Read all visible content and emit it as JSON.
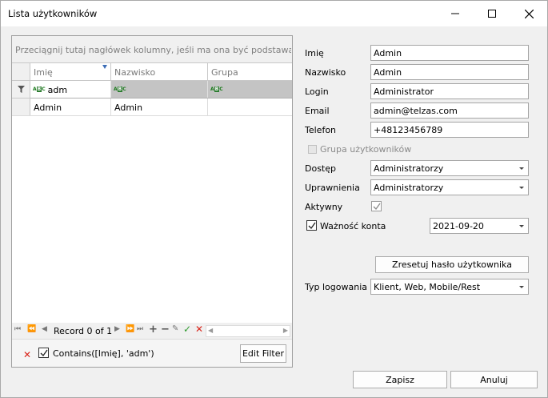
{
  "window": {
    "title": "Lista użytkowników"
  },
  "grid": {
    "group_panel_text": "Przeciągnij tutaj nagłówek kolumny, jeśli ma ona być podstawą grupow",
    "columns": [
      "Imię",
      "Nazwisko",
      "Grupa"
    ],
    "filter_row": {
      "imie": "adm",
      "nazwisko": "",
      "grupa": ""
    },
    "rows": [
      {
        "imie": "Admin",
        "nazwisko": "Admin",
        "grupa": ""
      }
    ],
    "navigator": {
      "record_text": "Record 0 of 1"
    },
    "filter_panel": {
      "text": "Contains([Imię], 'adm')",
      "edit_filter_label": "Edit Filter",
      "enabled": true
    }
  },
  "form": {
    "imie": {
      "label": "Imię",
      "value": "Admin"
    },
    "nazwisko": {
      "label": "Nazwisko",
      "value": "Admin"
    },
    "login": {
      "label": "Login",
      "value": "Administrator"
    },
    "email": {
      "label": "Email",
      "value": "admin@telzas.com"
    },
    "telefon": {
      "label": "Telefon",
      "value": "+48123456789"
    },
    "grupa_uzytkownikow": {
      "label": "Grupa użytkowników",
      "checked": false,
      "disabled": true
    },
    "dostep": {
      "label": "Dostęp",
      "value": "Administratorzy"
    },
    "uprawnienia": {
      "label": "Uprawnienia",
      "value": "Administratorzy"
    },
    "aktywny": {
      "label": "Aktywny",
      "checked": true
    },
    "waznosc": {
      "label": "Ważność konta",
      "checked": true,
      "date": "2021-09-20"
    },
    "reset_button": "Zresetuj hasło użytkownika",
    "typ_logowania": {
      "label": "Typ logowania",
      "value": "Klient, Web, Mobile/Rest"
    }
  },
  "footer": {
    "save_label": "Zapisz",
    "cancel_label": "Anuluj"
  }
}
